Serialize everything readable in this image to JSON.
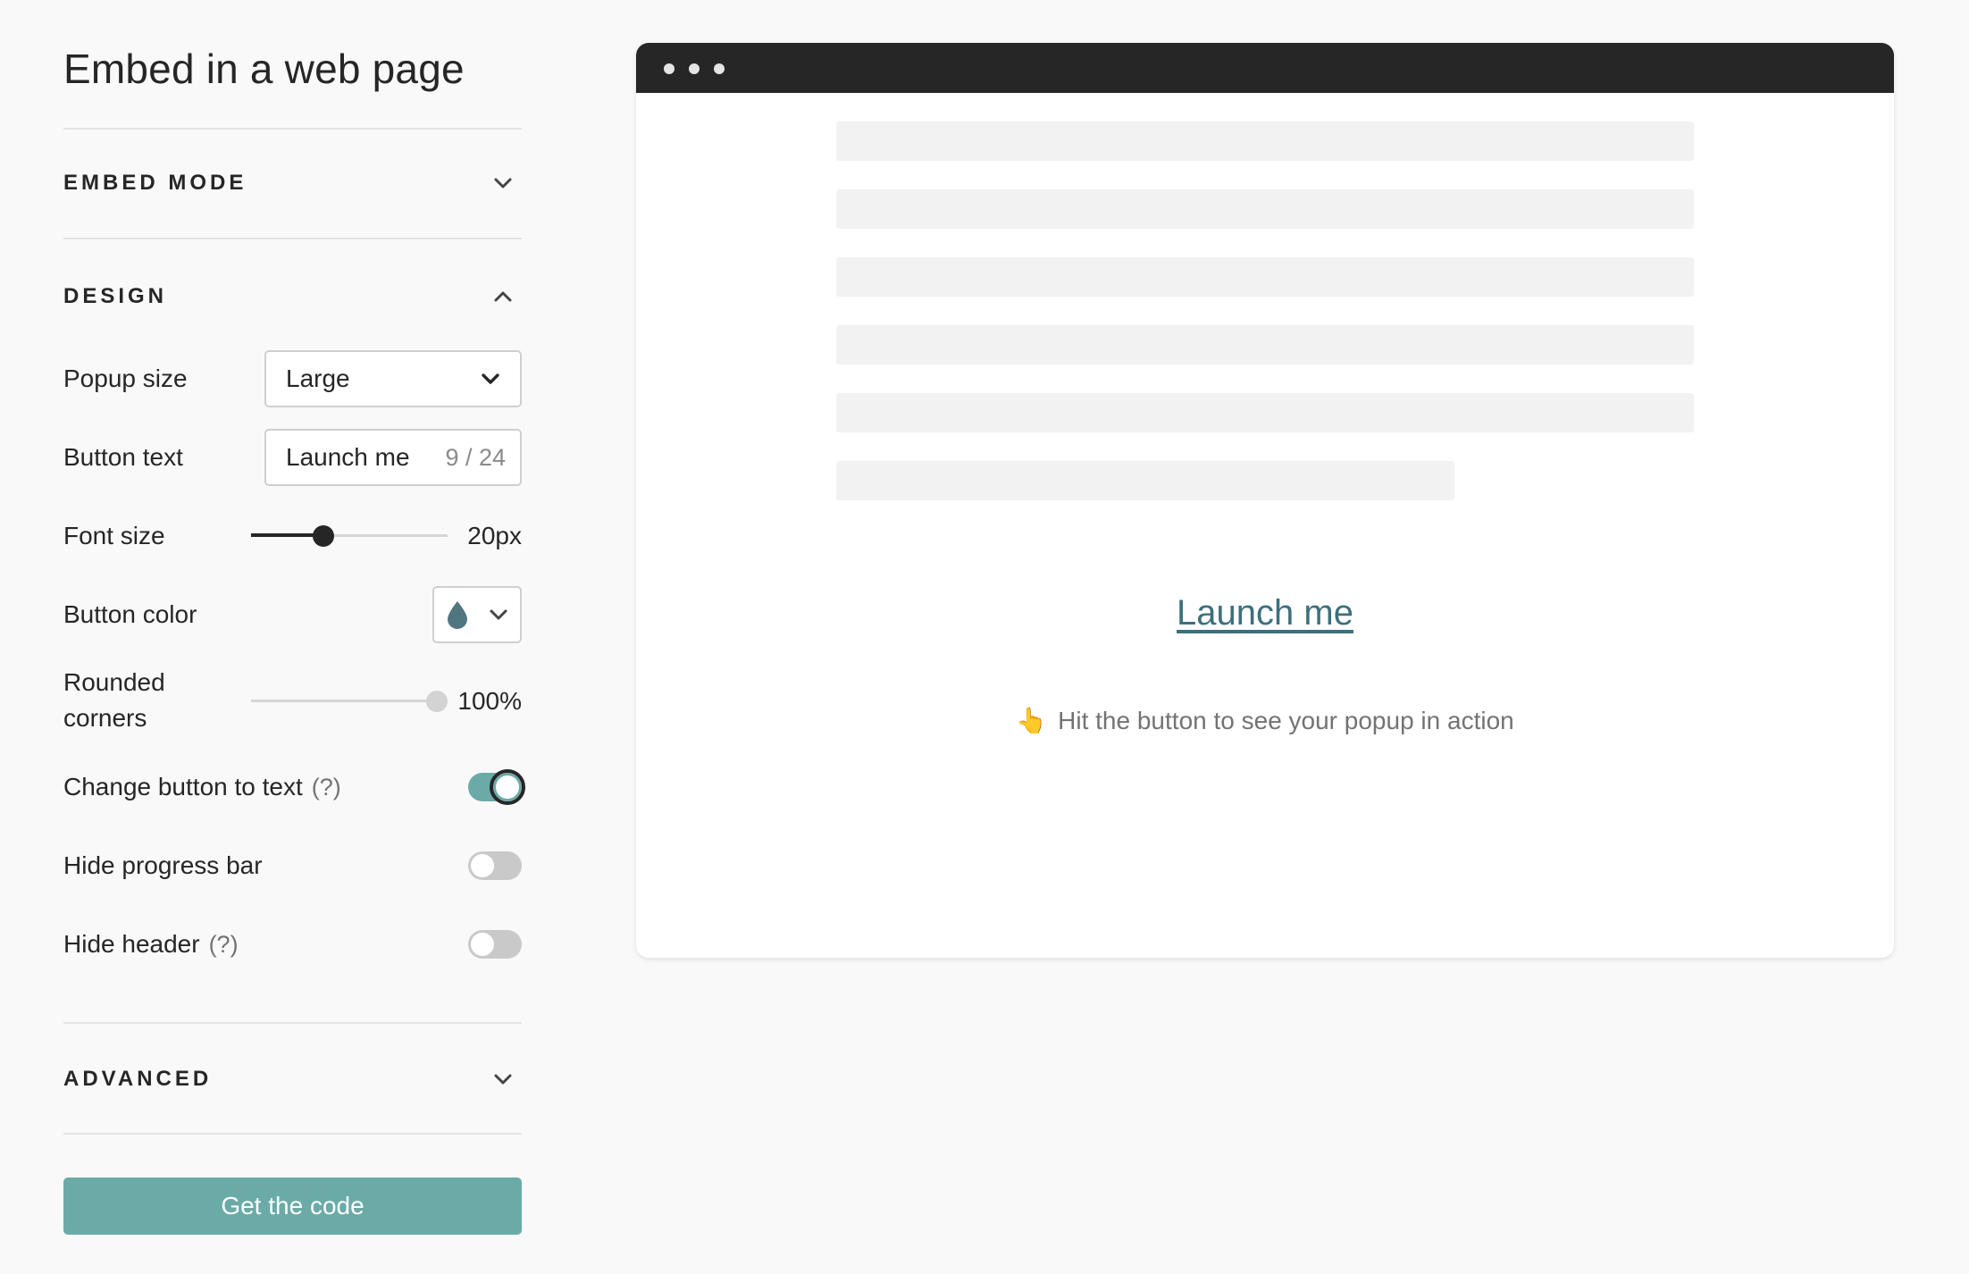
{
  "panel": {
    "title": "Embed in a web page",
    "sections": {
      "embed_mode": "EMBED MODE",
      "design": "DESIGN",
      "advanced": "ADVANCED"
    },
    "popup_size": {
      "label": "Popup size",
      "value": "Large"
    },
    "button_text": {
      "label": "Button text",
      "value": "Launch me",
      "counter": "9 / 24"
    },
    "font_size": {
      "label": "Font size",
      "value_text": "20px",
      "fraction": 0.35
    },
    "button_color": {
      "label": "Button color",
      "color": "#4f7681",
      "icon": "droplet-icon"
    },
    "rounded_corners": {
      "label_line1": "Rounded",
      "label_line2": "corners",
      "value_text": "100%",
      "fraction": 1.0
    },
    "change_button_to_text": {
      "label": "Change button to text",
      "help": "(?)",
      "on": true
    },
    "hide_progress_bar": {
      "label": "Hide progress bar",
      "on": false
    },
    "hide_header": {
      "label": "Hide header",
      "help": "(?)",
      "on": false
    },
    "cta": "Get the code"
  },
  "preview": {
    "link_text": "Launch me",
    "hint_emoji": "👆",
    "hint_text": "Hit the button to see your popup in action"
  },
  "colors": {
    "accent": "#6aaba8",
    "link": "#3d6f7d",
    "titlebar": "#262627"
  }
}
